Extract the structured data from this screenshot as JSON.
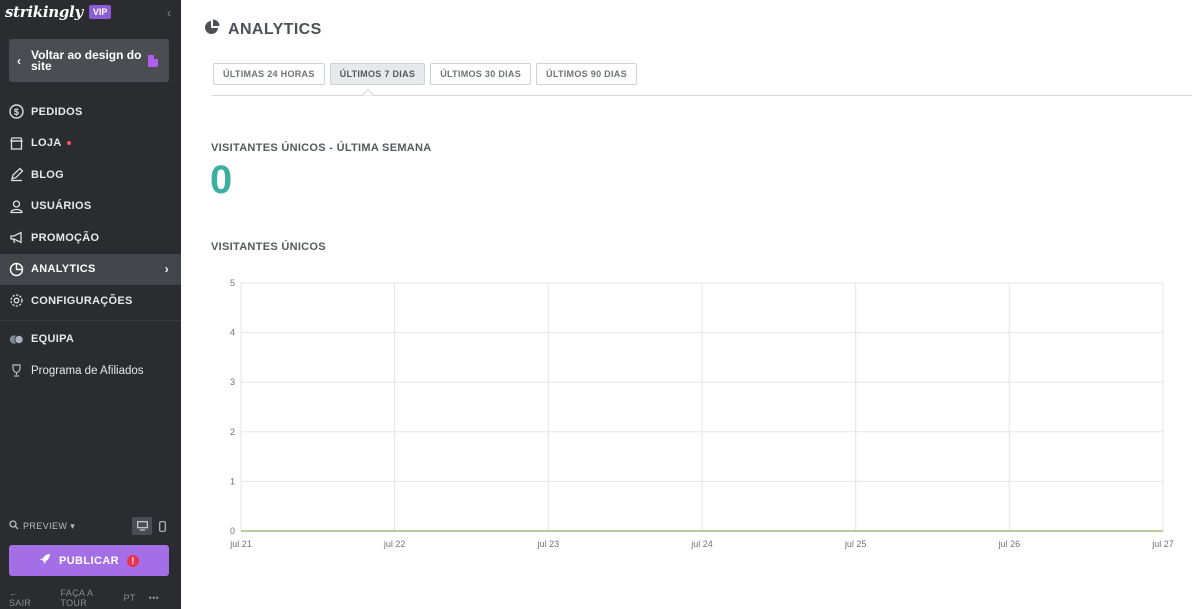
{
  "sidebar": {
    "brand": "strikingly",
    "vip_badge": "VIP",
    "back_button": "Voltar ao design do site",
    "nav": [
      {
        "label": "PEDIDOS",
        "icon": "dollar-icon"
      },
      {
        "label": "LOJA",
        "icon": "store-icon",
        "badge_dot": true
      },
      {
        "label": "BLOG",
        "icon": "pen-icon"
      },
      {
        "label": "USUÁRIOS",
        "icon": "users-icon"
      },
      {
        "label": "PROMOÇÃO",
        "icon": "megaphone-icon"
      },
      {
        "label": "ANALYTICS",
        "icon": "pie-chart-icon",
        "active": true
      },
      {
        "label": "CONFIGURAÇÕES",
        "icon": "gear-icon"
      }
    ],
    "team": {
      "label": "EQUIPA",
      "icon": "team-avatars-icon"
    },
    "affiliates": {
      "label": "Programa de Afiliados",
      "icon": "trophy-icon"
    },
    "preview_label": "PREVIEW",
    "publish_label": "PUBLICAR",
    "publish_alert": "!",
    "footer": {
      "exit": "SAIR",
      "tour": "FAÇA A TOUR",
      "lang": "PT",
      "more": "•••"
    }
  },
  "header": {
    "title": "ANALYTICS"
  },
  "tabs": [
    {
      "label": "ÚLTIMAS 24 HORAS",
      "active": false
    },
    {
      "label": "ÚLTIMOS 7 DIAS",
      "active": true
    },
    {
      "label": "ÚLTIMOS 30 DIAS",
      "active": false
    },
    {
      "label": "ÚLTIMOS 90 DIAS",
      "active": false
    }
  ],
  "summary": {
    "label": "VISITANTES ÚNICOS - ÚLTIMA SEMANA",
    "value": "0"
  },
  "chart_section": {
    "label": "VISITANTES ÚNICOS"
  },
  "colors": {
    "accent_teal": "#3bb0a0",
    "publish_purple": "#a46fe6",
    "sidebar_bg": "#2a2c2f",
    "line_green": "#8bb35a"
  },
  "chart_data": {
    "type": "line",
    "title": "VISITANTES ÚNICOS",
    "categories": [
      "jul 21",
      "jul 22",
      "jul 23",
      "jul 24",
      "jul 25",
      "jul 26",
      "jul 27"
    ],
    "series": [
      {
        "values": [
          0,
          0,
          0,
          0,
          0,
          0,
          0
        ]
      }
    ],
    "ylim": [
      0,
      5
    ],
    "yticks": [
      0,
      1,
      2,
      3,
      4,
      5
    ],
    "grid": true
  }
}
